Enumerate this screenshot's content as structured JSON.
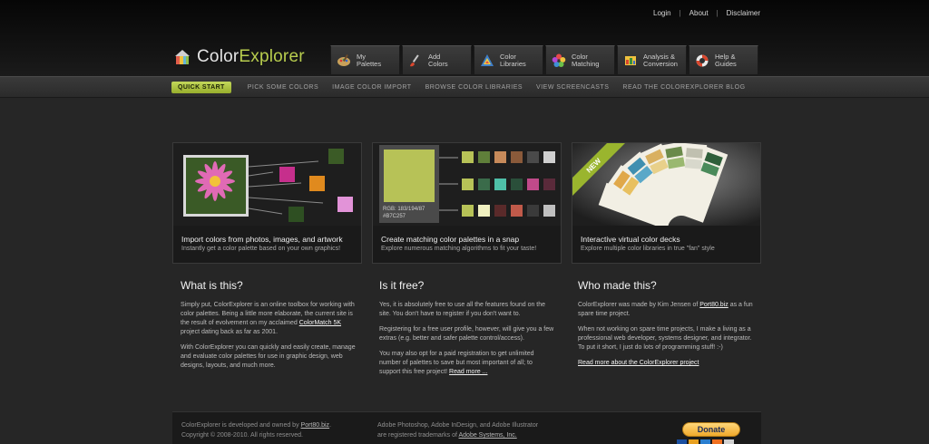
{
  "utility_nav": {
    "login": "Login",
    "about": "About",
    "disclaimer": "Disclaimer"
  },
  "logo": {
    "part1": "Color",
    "part2": "Explorer"
  },
  "main_nav": [
    {
      "label": "My\nPalettes",
      "icon": "palette-icon"
    },
    {
      "label": "Add\nColors",
      "icon": "brush-icon"
    },
    {
      "label": "Color\nLibraries",
      "icon": "color-library-icon"
    },
    {
      "label": "Color\nMatching",
      "icon": "color-wheel-icon"
    },
    {
      "label": "Analysis &\nConversion",
      "icon": "analysis-icon"
    },
    {
      "label": "Help &\nGuides",
      "icon": "lifebuoy-icon"
    }
  ],
  "subnav": {
    "quick_start": "QUICK START",
    "links": [
      "PICK SOME COLORS",
      "IMAGE COLOR IMPORT",
      "BROWSE COLOR LIBRARIES",
      "VIEW SCREENCASTS",
      "READ THE COLOREXPLORER BLOG"
    ]
  },
  "features": [
    {
      "title": "Import colors from photos, images, and artwork",
      "subtitle": "Instantly get a color palette based on your own graphics!"
    },
    {
      "title": "Create matching color palettes in a snap",
      "subtitle": "Explore numerous matching algorithms to fit your taste!",
      "swatch_label": "RGB: 183/194/87\n#B7C257"
    },
    {
      "title": "Interactive virtual color decks",
      "subtitle": "Explore multiple color libraries in true \"fan\" style",
      "ribbon": "NEW"
    }
  ],
  "columns": [
    {
      "heading": "What is this?",
      "p1": "Simply put, ColorExplorer is an online toolbox for working with color palettes. Being a little more elaborate, the current site is the result of evolvement on my acclaimed ",
      "p1_link": "ColorMatch 5K",
      "p1_end": " project dating back as far as 2001.",
      "p2": "With ColorExplorer you can quickly and easily create, manage and evaluate color palettes for use in graphic design, web designs, layouts, and much more."
    },
    {
      "heading": "Is it free?",
      "p1": "Yes, it is absolutely free to use all the features found on the site. You don't have to register if you don't want to.",
      "p2": "Registering for a free user profile, however, will give you a few extras (e.g. better and safer palette control/access).",
      "p3": "You may also opt for a paid registration to get unlimited number of palettes to save but most important of all; to support this free project! ",
      "p3_link": "Read more ..."
    },
    {
      "heading": "Who made this?",
      "p1": "ColorExplorer was made by Kim Jensen of ",
      "p1_link": "Port80.biz",
      "p1_end": " as a fun spare time project.",
      "p2": "When not working on spare time projects, I make a living as a professional web developer, systems designer, and integrator. To put it short, I just do lots of programming stuff! :-)",
      "p3_link": "Read more about the ColorExplorer project"
    }
  ],
  "footer": {
    "left_1": "ColorExplorer is developed and owned by ",
    "left_link": "Port80.biz",
    "left_1_end": ".",
    "left_2": "Copyright © 2008-2010. All rights reserved.",
    "mid_1": "Adobe Photoshop, Adobe InDesign, and Adobe Illustrator",
    "mid_2": "are registered trademarks of ",
    "mid_link": "Adobe Systems, Inc.",
    "donate": "Donate"
  },
  "colors": {
    "accent_green": "#b7c257",
    "background": "#262626",
    "panel": "#1a1a1a"
  }
}
